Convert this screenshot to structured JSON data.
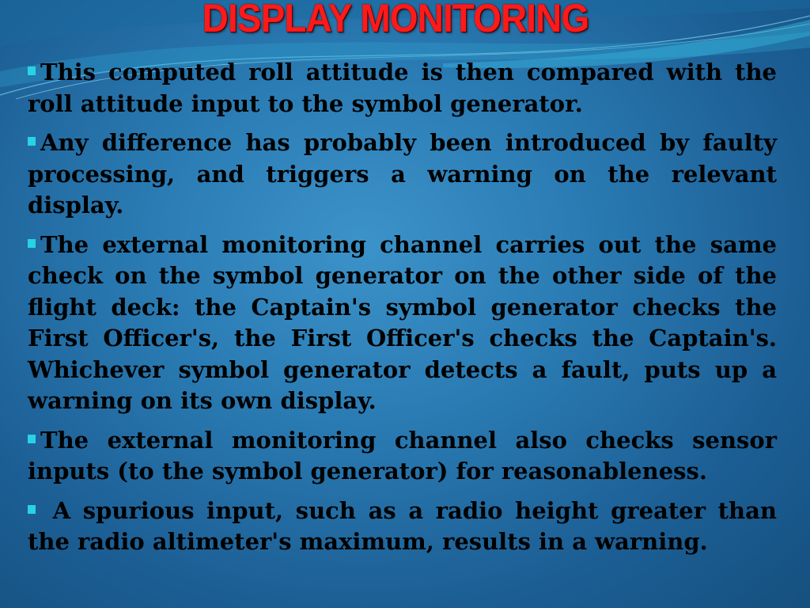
{
  "slide": {
    "title": "DISPLAY MONITORING",
    "colors": {
      "title": "#ff1a1a",
      "bullet": "#29d2e6",
      "background": "#2a7bb3",
      "text": "#000000"
    },
    "bullet_icon": "square-bullet",
    "paragraphs": [
      "This computed roll attitude is then compared with the roll attitude input to the symbol generator.",
      "Any difference has probably been introduced by faulty processing, and triggers a warning on the relevant display.",
      "The external monitoring channel carries out the same check on the symbol generator on the other side of the flight deck: the Captain's symbol generator checks the First Officer's, the First Officer's checks the Captain's. Whichever symbol generator detects a fault, puts up a warning on its own display.",
      "The external monitoring channel also checks sensor inputs (to the symbol generator) for reasonableness.",
      " A spurious input, such as a radio height greater than the radio altimeter's maximum, results in a warning."
    ]
  }
}
